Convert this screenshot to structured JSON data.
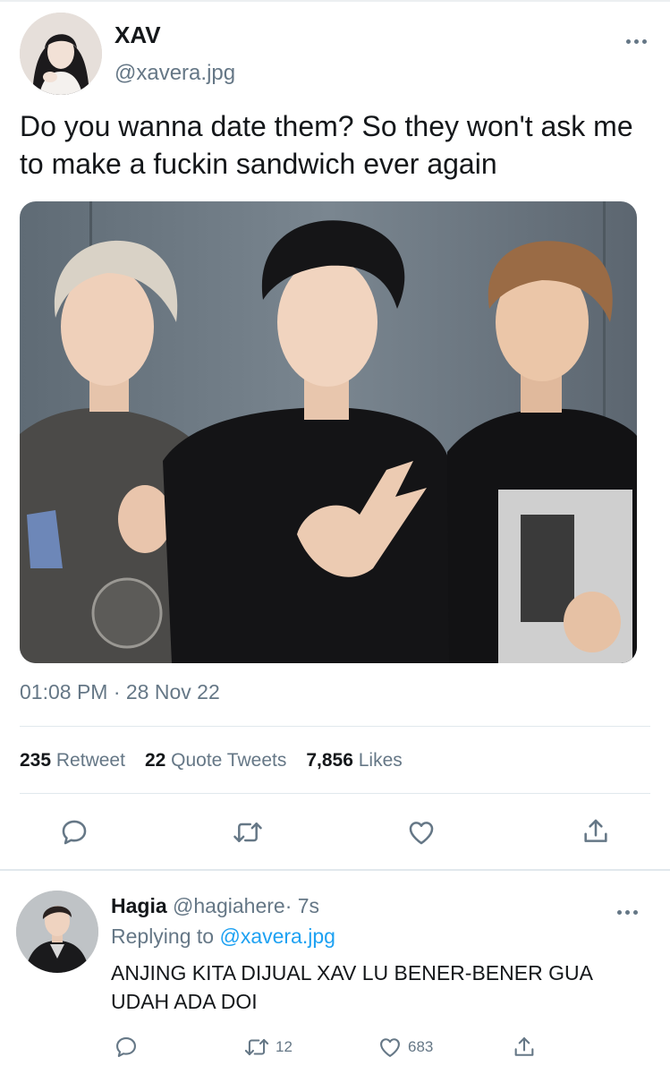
{
  "tweet": {
    "author_name": "XAV",
    "author_handle": "@xavera.jpg",
    "text": "Do you wanna date them? So they won't ask me to make a fuckin sandwich ever again",
    "timestamp": "01:08 PM · 28 Nov 22",
    "stats": {
      "retweets_count": "235",
      "retweets_label": "Retweet",
      "quotes_count": "22",
      "quotes_label": "Quote Tweets",
      "likes_count": "7,856",
      "likes_label": "Likes"
    },
    "actions": [
      "reply-icon",
      "retweet-icon",
      "like-icon",
      "share-icon"
    ]
  },
  "reply": {
    "author_name": "Hagia",
    "author_handle": "@hagiahere",
    "separator": "·",
    "time_ago": "7s",
    "replying_label": "Replying to",
    "replying_to": "@xavera.jpg",
    "text": "ANJING KITA DIJUAL XAV LU BENER-BENER GUA UDAH ADA DOI",
    "retweet_count": "12",
    "like_count": "683"
  },
  "colors": {
    "link": "#1da1f2",
    "secondary_text": "#657786",
    "primary_text": "#14171a",
    "divider": "#e1e8ed"
  }
}
